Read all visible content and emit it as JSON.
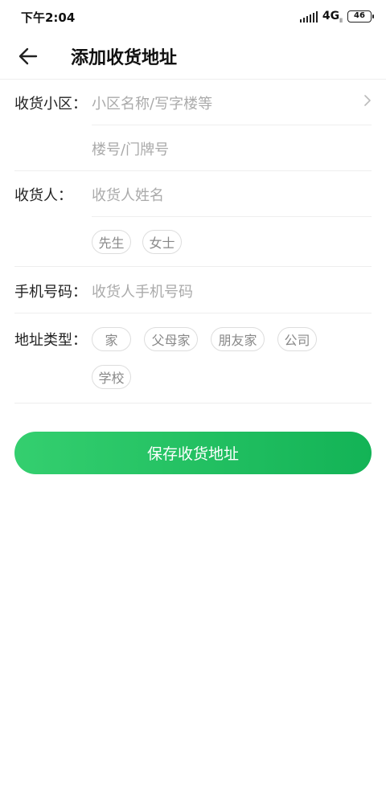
{
  "status_bar": {
    "time": "下午2:04",
    "network": "4G",
    "network_sub": "ll",
    "battery": "46",
    "battery_level": 46
  },
  "nav": {
    "back_icon": "arrow-left-icon",
    "title": "添加收货地址"
  },
  "form": {
    "community": {
      "label": "收货小区：",
      "placeholder": "小区名称/写字楼等"
    },
    "building": {
      "placeholder": "楼号/门牌号"
    },
    "consignee": {
      "label": "收货人：",
      "placeholder": "收货人姓名",
      "genders": [
        "先生",
        "女士"
      ]
    },
    "phone": {
      "label": "手机号码：",
      "placeholder": "收货人手机号码"
    },
    "address_type": {
      "label": "地址类型：",
      "options": [
        "家",
        "父母家",
        "朋友家",
        "公司",
        "学校"
      ]
    }
  },
  "actions": {
    "save_label": "保存收货地址"
  },
  "colors": {
    "accent_start": "#34cf6f",
    "accent_end": "#13b356",
    "placeholder": "#aaaaaa",
    "divider": "#eeeeee"
  }
}
